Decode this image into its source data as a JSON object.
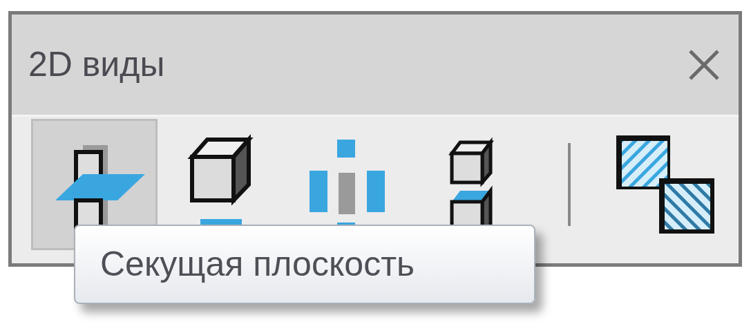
{
  "panel": {
    "title": "2D виды"
  },
  "tools": [
    {
      "kind": "tool",
      "selected": true
    },
    {
      "kind": "tool",
      "selected": false
    },
    {
      "kind": "tool",
      "selected": false
    },
    {
      "kind": "tool",
      "selected": false
    },
    {
      "kind": "separator"
    },
    {
      "kind": "tool",
      "selected": false
    }
  ],
  "tooltip": {
    "text": "Секущая плоскость"
  }
}
